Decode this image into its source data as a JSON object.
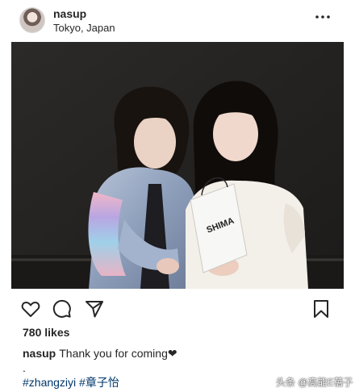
{
  "post": {
    "username": "nasup",
    "location": "Tokyo, Japan",
    "likes": "780 likes",
    "caption_user": "nasup",
    "caption_text": "Thank you for coming❤",
    "caption_dot": ".",
    "hashtags": "#zhangziyi #章子怡"
  },
  "photo": {
    "bag_text": "SHIMA"
  },
  "icons": {
    "more": "more-options-icon",
    "like": "heart-icon",
    "comment": "comment-icon",
    "share": "share-icon",
    "save": "bookmark-icon"
  },
  "watermark": "头条 @高能E蓓子",
  "colors": {
    "text": "#262626",
    "hashtag": "#00376b",
    "photo_background": "#252321"
  }
}
